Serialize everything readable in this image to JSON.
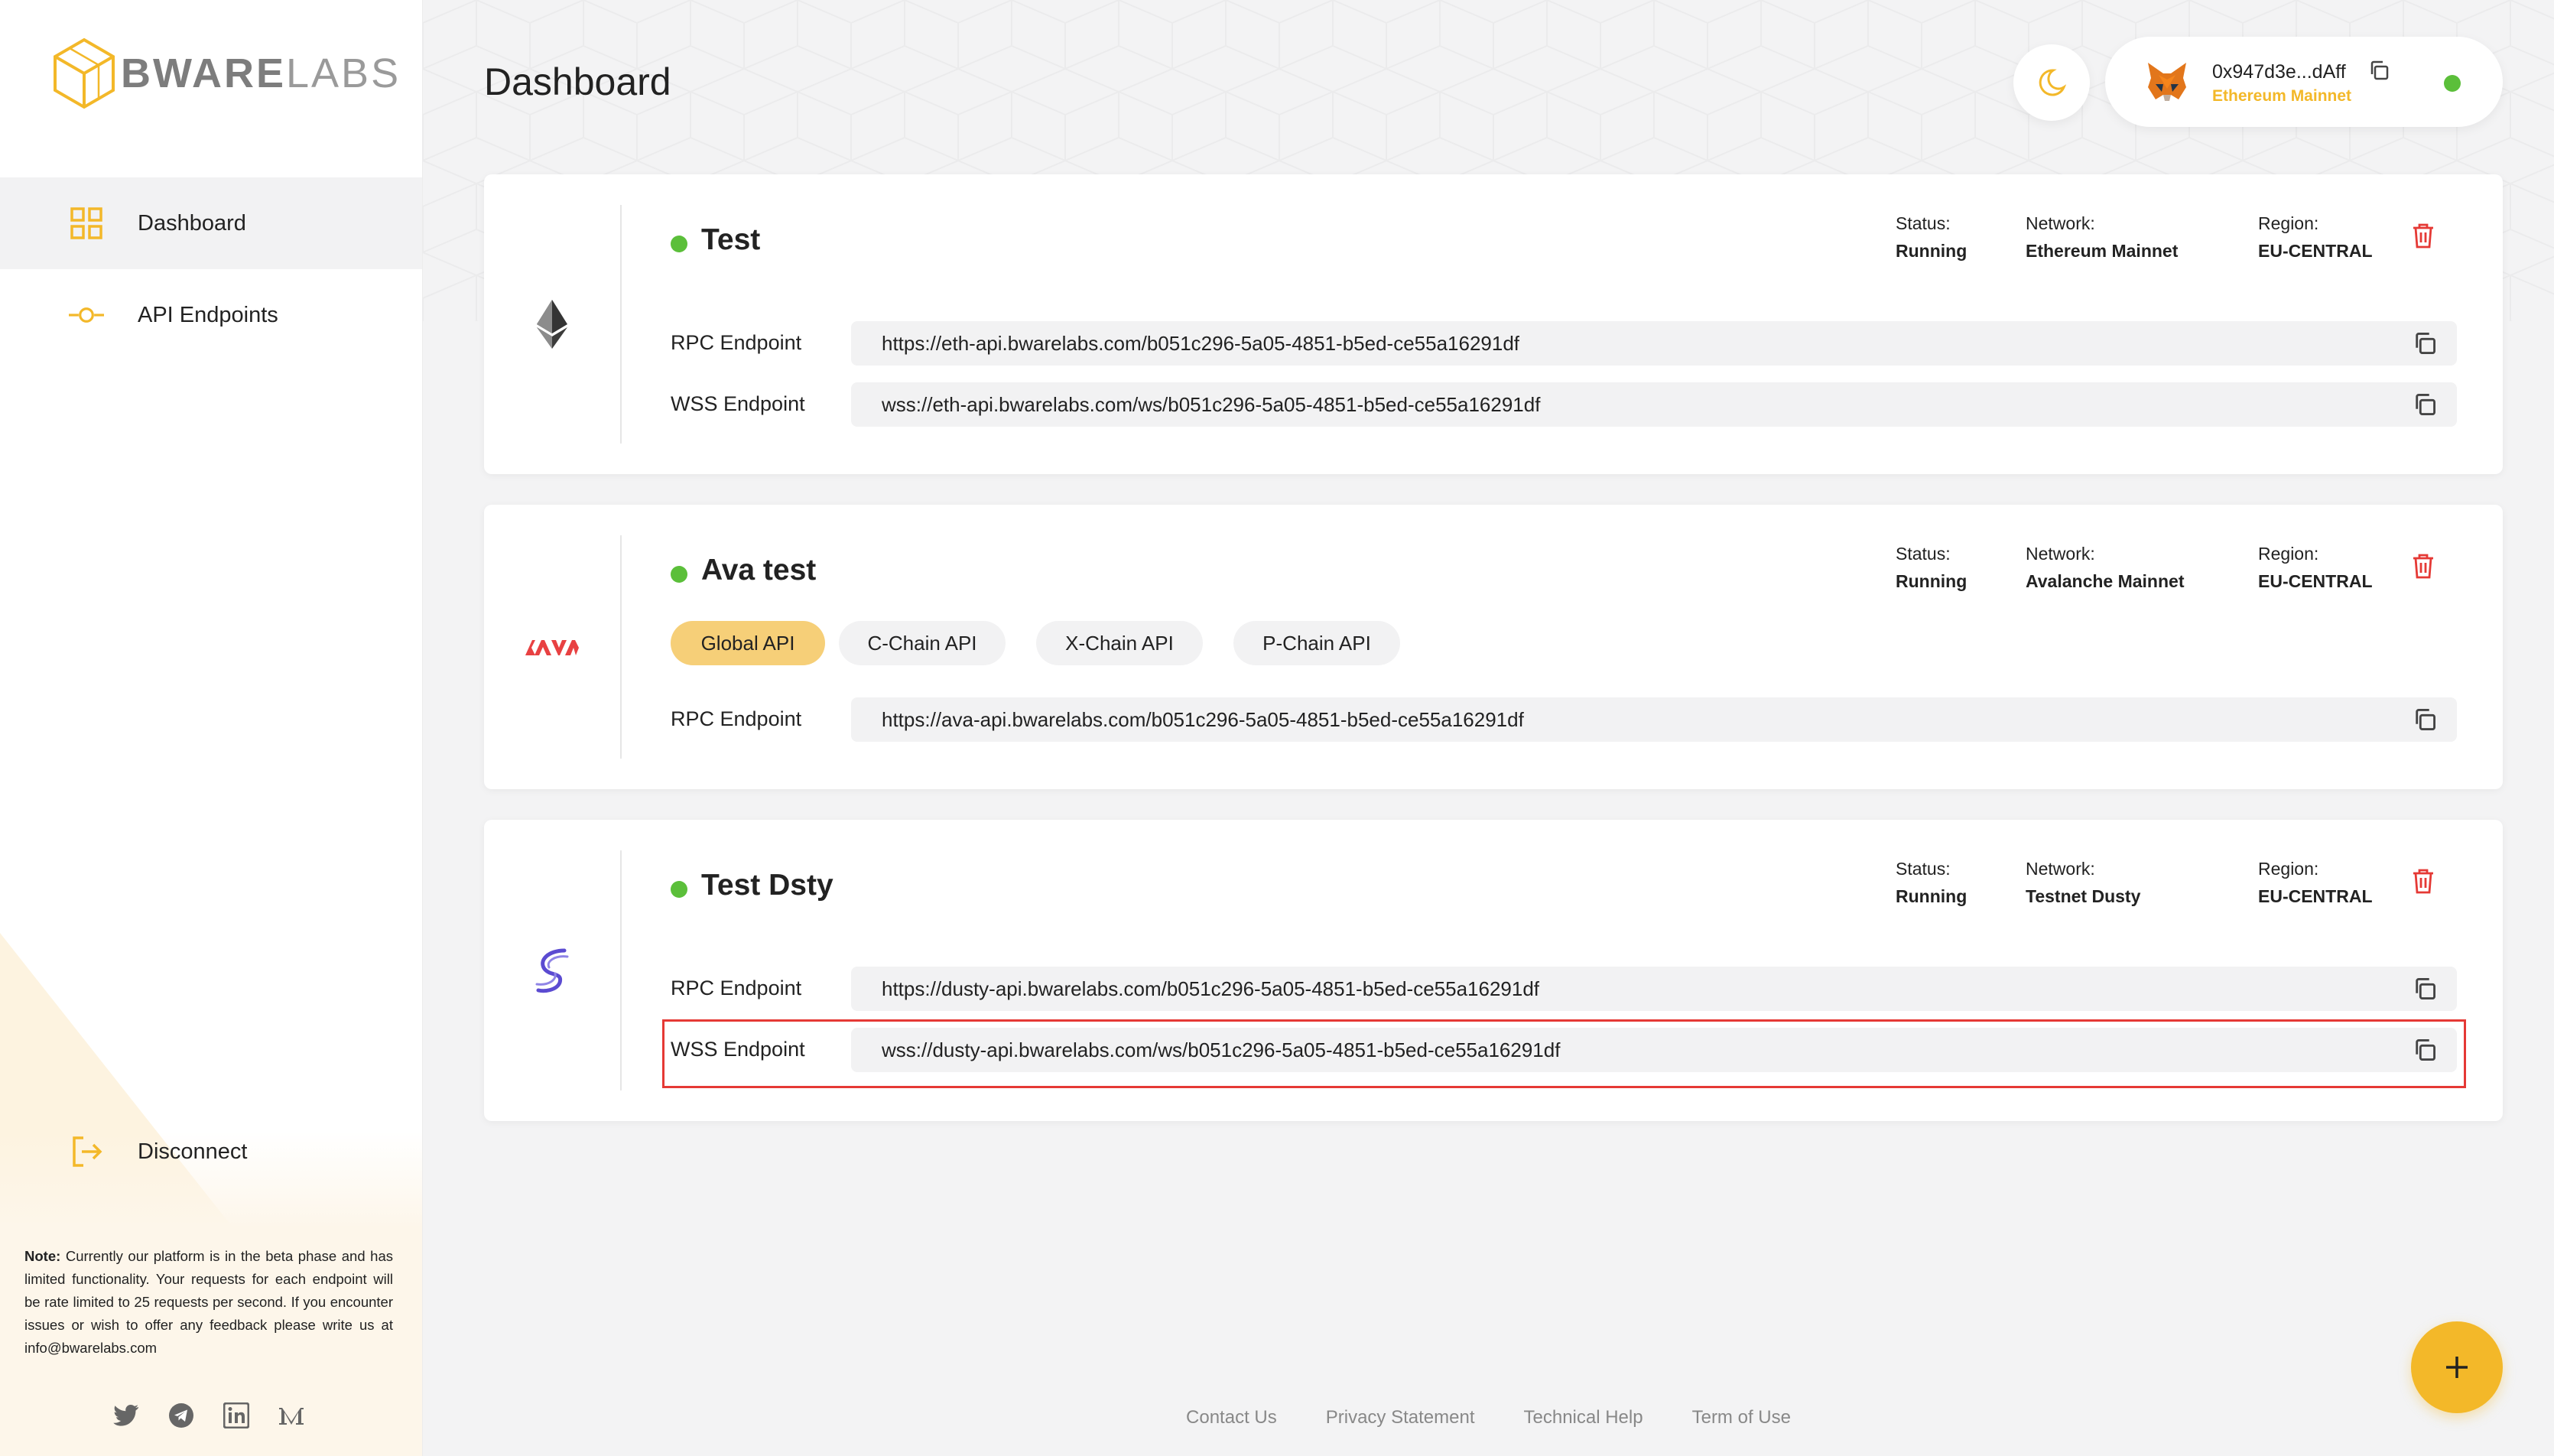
{
  "app": {
    "logo_text": "BWARELABS",
    "logo_bold": "BWARE",
    "logo_light": "LABS"
  },
  "sidebar": {
    "items": [
      {
        "label": "Dashboard",
        "icon": "grid-icon",
        "active": true
      },
      {
        "label": "API Endpoints",
        "icon": "endpoint-icon",
        "active": false
      }
    ],
    "disconnect_label": "Disconnect",
    "note_prefix": "Note:",
    "note_text": " Currently our platform is in the beta phase and has limited functionality. Your requests for each endpoint will be rate limited to 25 requests per second. If you encounter issues or wish to offer any feedback please write us at info@bwarelabs.com",
    "socials": [
      "twitter-icon",
      "telegram-icon",
      "linkedin-icon",
      "medium-icon"
    ]
  },
  "header": {
    "title": "Dashboard",
    "wallet_address": "0x947d3e...dAff",
    "wallet_network": "Ethereum Mainnet"
  },
  "cards": [
    {
      "name": "Test",
      "chain_icon": "ethereum-icon",
      "status_label": "Status:",
      "status_value": "Running",
      "network_label": "Network:",
      "network_value": "Ethereum Mainnet",
      "region_label": "Region:",
      "region_value": "EU-CENTRAL",
      "rpc_label": "RPC Endpoint",
      "rpc_url": "https://eth-api.bwarelabs.com/b051c296-5a05-4851-b5ed-ce55a16291df",
      "wss_label": "WSS Endpoint",
      "wss_url": "wss://eth-api.bwarelabs.com/ws/b051c296-5a05-4851-b5ed-ce55a16291df"
    },
    {
      "name": "Ava test",
      "chain_icon": "avalanche-icon",
      "status_label": "Status:",
      "status_value": "Running",
      "network_label": "Network:",
      "network_value": "Avalanche Mainnet",
      "region_label": "Region:",
      "region_value": "EU-CENTRAL",
      "tabs": [
        "Global API",
        "C-Chain API",
        "X-Chain API",
        "P-Chain API"
      ],
      "active_tab": "Global API",
      "rpc_label": "RPC Endpoint",
      "rpc_url": "https://ava-api.bwarelabs.com/b051c296-5a05-4851-b5ed-ce55a16291df"
    },
    {
      "name": "Test Dsty",
      "chain_icon": "dusty-icon",
      "status_label": "Status:",
      "status_value": "Running",
      "network_label": "Network:",
      "network_value": "Testnet Dusty",
      "region_label": "Region:",
      "region_value": "EU-CENTRAL",
      "rpc_label": "RPC Endpoint",
      "rpc_url": "https://dusty-api.bwarelabs.com/b051c296-5a05-4851-b5ed-ce55a16291df",
      "wss_label": "WSS Endpoint",
      "wss_url": "wss://dusty-api.bwarelabs.com/ws/b051c296-5a05-4851-b5ed-ce55a16291df"
    }
  ],
  "footer": {
    "links": [
      "Contact Us",
      "Privacy Statement",
      "Technical Help",
      "Term of Use"
    ]
  },
  "colors": {
    "accent": "#f3b829",
    "status_green": "#5bbf3a",
    "danger": "#e53935",
    "highlight": "#e53935"
  }
}
